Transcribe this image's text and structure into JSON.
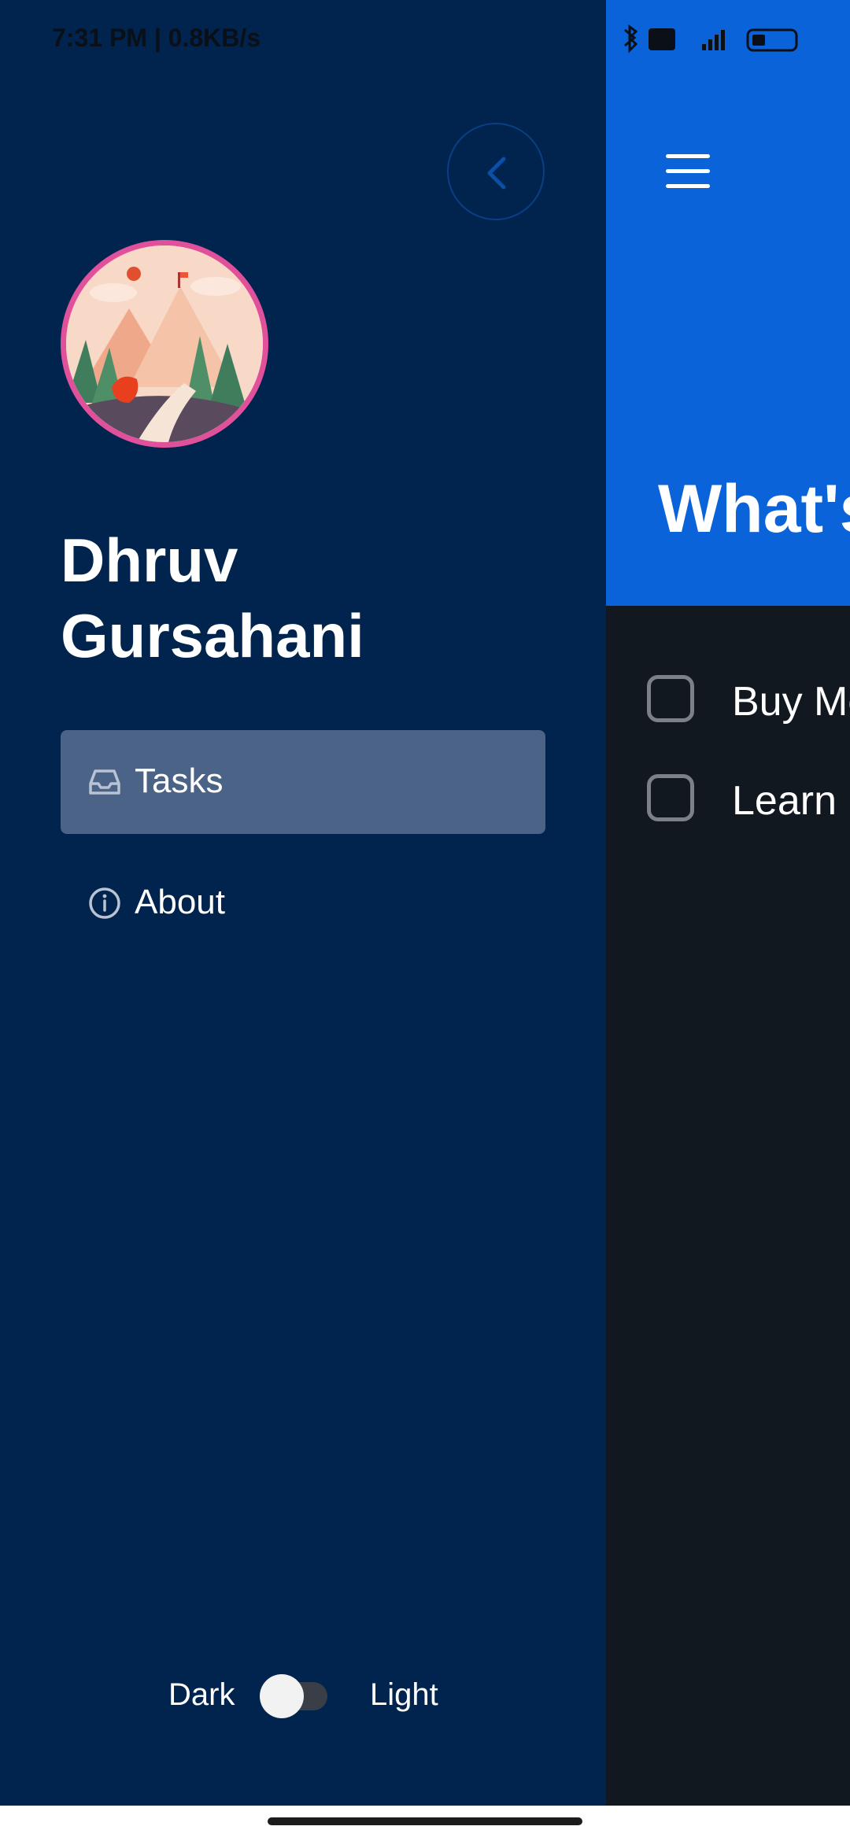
{
  "status_bar": {
    "time_speed": "7:31 PM | 0.8KB/s",
    "right_icons": [
      "bluetooth-icon",
      "volte-icon",
      "4g-signal-icon",
      "battery-icon"
    ]
  },
  "drawer": {
    "user_name": "Dhruv Gursahani",
    "nav": [
      {
        "label": "Tasks",
        "icon": "inbox-icon",
        "active": true
      },
      {
        "label": "About",
        "icon": "info-icon",
        "active": false
      }
    ],
    "theme": {
      "dark_label": "Dark",
      "light_label": "Light",
      "mode": "Dark"
    }
  },
  "app": {
    "hero_title": "What's",
    "tasks": [
      "Buy Mo",
      "Learn"
    ]
  },
  "colors": {
    "drawer_bg": "#00244D",
    "active_item": "#4A6386",
    "hero_blue": "#0A63D9",
    "sheet_bg": "#121820",
    "avatar_ring": "#E0509B"
  }
}
